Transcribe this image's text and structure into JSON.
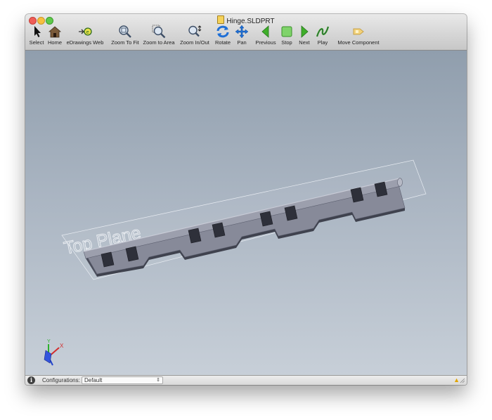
{
  "window": {
    "title": "Hinge.SLDPRT"
  },
  "toolbar": {
    "items": [
      {
        "label": "Select",
        "icon": "arrow-cursor-icon"
      },
      {
        "label": "Home",
        "icon": "home-icon"
      },
      {
        "label": "eDrawings Web",
        "icon": "edrawings-web-icon"
      },
      {
        "label": "Zoom To Fit",
        "icon": "zoom-to-fit-icon"
      },
      {
        "label": "Zoom to Area",
        "icon": "zoom-to-area-icon"
      },
      {
        "label": "Zoom In/Out",
        "icon": "zoom-in-out-icon"
      },
      {
        "label": "Rotate",
        "icon": "rotate-icon"
      },
      {
        "label": "Pan",
        "icon": "pan-icon"
      },
      {
        "label": "Previous",
        "icon": "previous-icon"
      },
      {
        "label": "Stop",
        "icon": "stop-icon"
      },
      {
        "label": "Next",
        "icon": "next-icon"
      },
      {
        "label": "Play",
        "icon": "play-icon"
      },
      {
        "label": "Move Component",
        "icon": "move-component-icon"
      }
    ]
  },
  "viewport": {
    "plane_label": "Top Plane",
    "triad": {
      "x": "X",
      "y": "Y"
    }
  },
  "statusbar": {
    "configurations_label": "Configurations:",
    "configuration_value": "Default"
  },
  "colors": {
    "accent_blue": "#1f6fd6",
    "nav_green": "#3fae2a",
    "warning": "#e0a400"
  }
}
